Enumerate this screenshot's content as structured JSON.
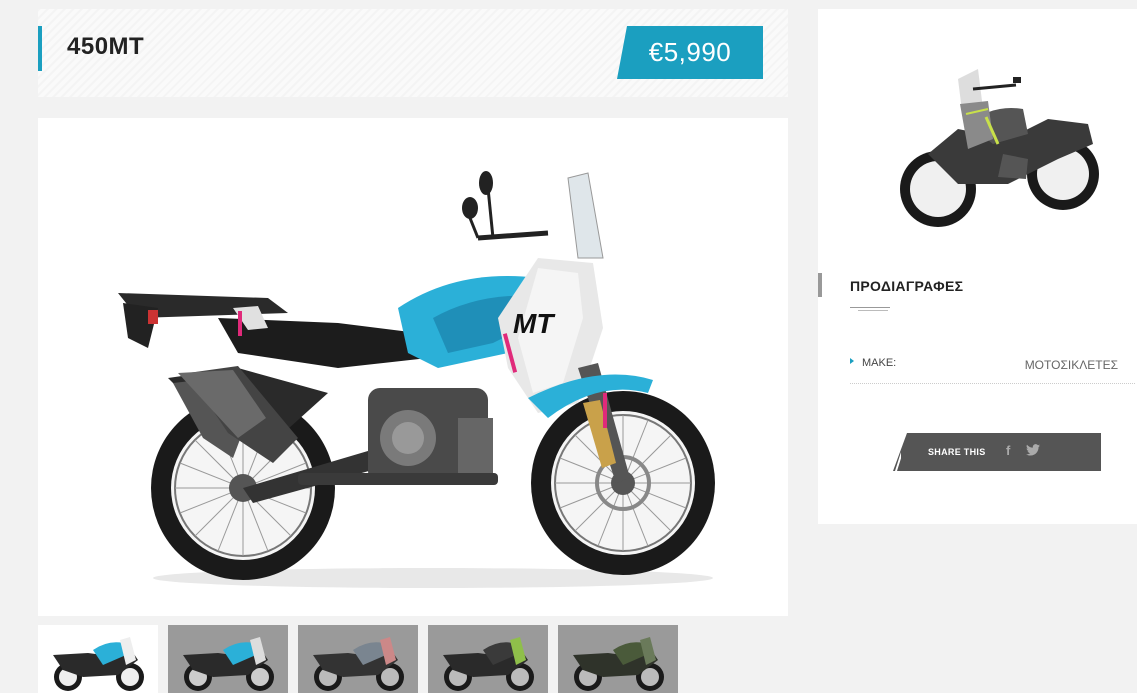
{
  "listing": {
    "title": "450MT",
    "price": "€5,990"
  },
  "gallery": {
    "thumbnails": [
      {
        "color": "#1b9fc0",
        "active": true
      },
      {
        "color": "#1b9fc0",
        "active": false
      },
      {
        "color": "#7a8590",
        "active": false
      },
      {
        "color": "#4a6a3a",
        "active": false
      },
      {
        "color": "#4a5a3a",
        "active": false
      }
    ]
  },
  "sidebar": {
    "specs_title": "ΠΡΟΔΙΑΓΡΑΦΕΣ",
    "specs": [
      {
        "label": "MAKE:",
        "value": "ΜΟΤΟΣΙΚΛΕΤΕΣ"
      }
    ],
    "share_label": "SHARE THIS",
    "share_icons": [
      "facebook-icon",
      "twitter-icon"
    ]
  },
  "colors": {
    "accent": "#1b9fc0",
    "share_bar": "#555555"
  }
}
